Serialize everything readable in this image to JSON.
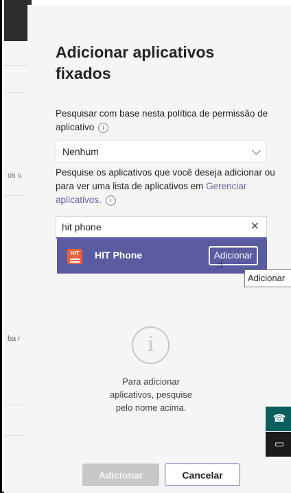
{
  "background": {
    "text_1": "us u",
    "text_2": "ba r"
  },
  "dialog": {
    "title": "Adicionar aplicativos fixados",
    "policy_desc": "Pesquisar com base nesta política de permissão de aplicativo",
    "policy_select_value": "Nenhum",
    "search_desc_prefix": "Pesquise os aplicativos que você deseja adicionar ou para ver uma lista de aplicativos em ",
    "search_desc_link": "Gerenciar aplicativos.",
    "search_value": "hit phone",
    "result": {
      "app_name": "HIT Phone",
      "add_label": "Adicionar"
    },
    "tooltip": "Adicionar",
    "empty_state": "Para adicionar aplicativos, pesquise pelo nome acima.",
    "footer": {
      "add_label": "Adicionar",
      "cancel_label": "Cancelar"
    }
  },
  "icons": {
    "info": "info-icon",
    "chevron": "chevron-down-icon",
    "clear": "close-icon",
    "headset": "headset-icon",
    "feedback": "feedback-icon"
  }
}
